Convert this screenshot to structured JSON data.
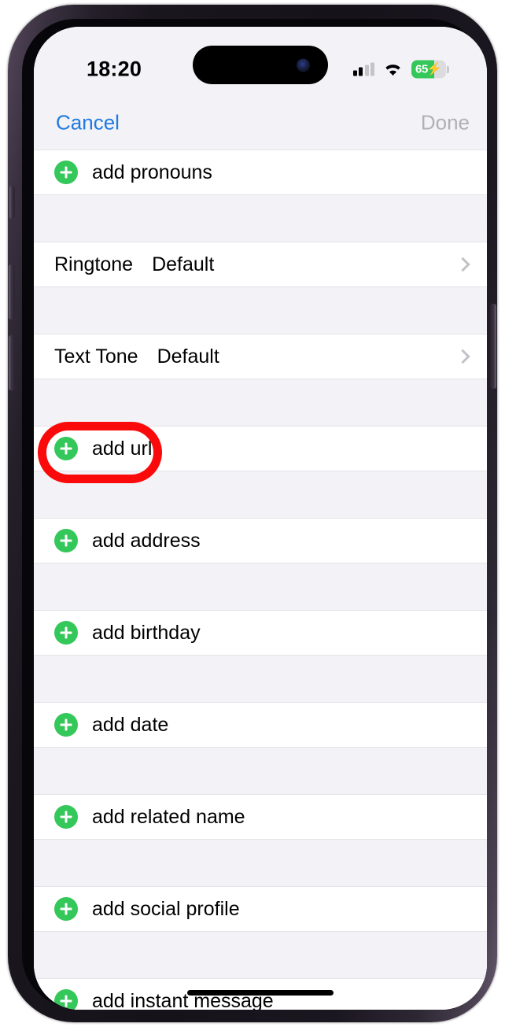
{
  "status_bar": {
    "time": "18:20",
    "cellular_icon": "cellular-signal-icon",
    "cellular_bars_filled": 2,
    "cellular_bars_total": 4,
    "wifi_icon": "wifi-icon",
    "battery_icon": "battery-charging-icon",
    "battery_percent": "65",
    "battery_charging_glyph": "⚡"
  },
  "nav_bar": {
    "cancel_label": "Cancel",
    "done_label": "Done",
    "cancel_color": "#1f7ae0",
    "done_color": "#b0b0b5"
  },
  "list": {
    "rows": [
      {
        "type": "add",
        "label": "add pronouns",
        "icon": "plus-circle-icon"
      },
      {
        "type": "detail",
        "label": "Ringtone",
        "value": "Default",
        "icon": "chevron-right-icon"
      },
      {
        "type": "detail",
        "label": "Text Tone",
        "value": "Default",
        "icon": "chevron-right-icon"
      },
      {
        "type": "add",
        "label": "add url",
        "icon": "plus-circle-icon",
        "highlighted": true
      },
      {
        "type": "add",
        "label": "add address",
        "icon": "plus-circle-icon"
      },
      {
        "type": "add",
        "label": "add birthday",
        "icon": "plus-circle-icon"
      },
      {
        "type": "add",
        "label": "add date",
        "icon": "plus-circle-icon"
      },
      {
        "type": "add",
        "label": "add related name",
        "icon": "plus-circle-icon"
      },
      {
        "type": "add",
        "label": "add social profile",
        "icon": "plus-circle-icon"
      },
      {
        "type": "add",
        "label": "add instant message",
        "icon": "plus-circle-icon"
      }
    ]
  },
  "annotation": {
    "shape": "oval-outline",
    "color": "#fa0a0a",
    "targets_row_label": "add url"
  },
  "colors": {
    "accent_green": "#34c759",
    "link_blue": "#1f7ae0",
    "group_background": "#f2f2f7",
    "row_background": "#ffffff",
    "separator": "#e3e3e8"
  },
  "home_indicator": "home-indicator-bar"
}
